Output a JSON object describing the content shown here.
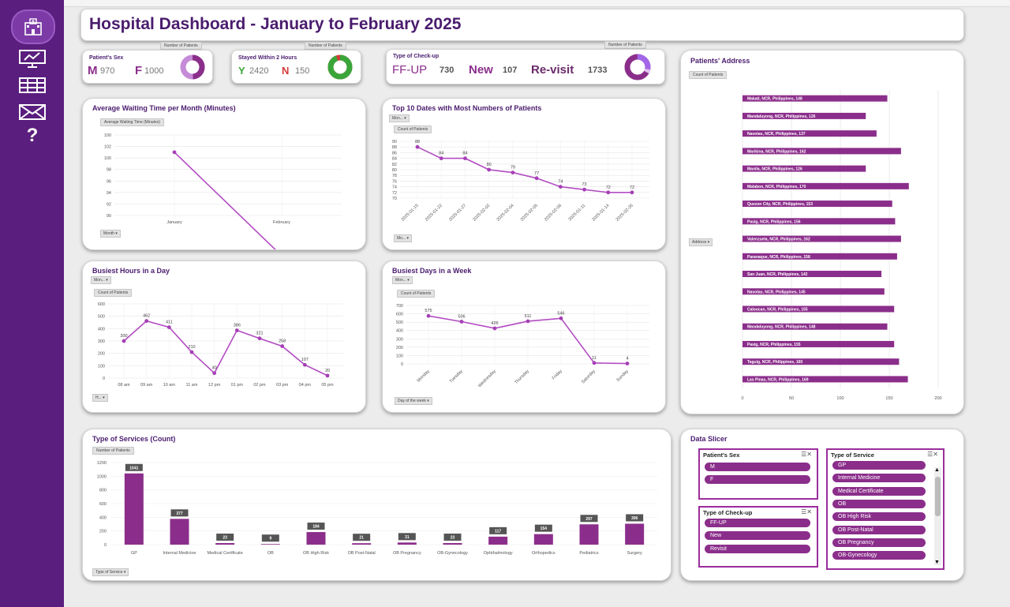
{
  "nav": {
    "icons": [
      "hospital-icon",
      "presentation-icon",
      "table-icon",
      "mail-icon",
      "help-icon"
    ],
    "help_glyph": "?"
  },
  "header": {
    "title": "Hospital Dashboard - January to February 2025"
  },
  "kpi_sex": {
    "title": "Patient's Sex",
    "pill": "Number of Patients",
    "m_letter": "M",
    "m_value": "970",
    "f_letter": "F",
    "f_value": "1000",
    "male_share": 0.49
  },
  "kpi_stayed": {
    "title": "Stayed Within 2 Hours",
    "pill": "Number of Patients",
    "y_letter": "Y",
    "y_value": "2420",
    "n_letter": "N",
    "n_value": "150",
    "yes_share": 0.94
  },
  "kpi_checkup": {
    "title": "Type of Check-up",
    "pill": "Number of Patients",
    "a_label": "FF-UP",
    "a_value": "730",
    "b_label": "New",
    "b_value": "107",
    "c_label": "Re-visit",
    "c_value": "1733"
  },
  "waiting": {
    "title": "Average Waiting Time per Month (Minutes)",
    "pill": "Average Waiting Time (Minutes)",
    "filter": "Month",
    "chart_data": {
      "type": "line",
      "categories": [
        "January",
        "February"
      ],
      "values": [
        101,
        83
      ],
      "yticks": [
        "100",
        "102",
        "100",
        "98",
        "96",
        "94",
        "92",
        "90"
      ],
      "ylim": [
        90,
        104
      ]
    }
  },
  "top_dates": {
    "title": "Top 10 Dates with Most Numbers of Patients",
    "dropdown": "Mon...",
    "pill": "Count of Patients",
    "filter": "Mo...",
    "chart_data": {
      "type": "line",
      "categories": [
        "2025-01-15",
        "2025-01-22",
        "2025-01-27",
        "2025-02-02",
        "2025-02-04",
        "2025-02-05",
        "2025-02-06",
        "2025-01-11",
        "2025-01-14",
        "2025-02-26"
      ],
      "values": [
        88,
        84,
        84,
        80,
        79,
        77,
        74,
        73,
        72,
        72
      ],
      "value_labels": [
        "88",
        "84",
        "84",
        "80",
        "79",
        "77",
        "74",
        "73",
        "72",
        "72"
      ],
      "ylim": [
        70,
        90
      ]
    }
  },
  "hours": {
    "title": "Busiest Hours in a Day",
    "dropdown": "Mon...",
    "pill": "Count of Patients",
    "filter": "H...",
    "chart_data": {
      "type": "line",
      "categories": [
        "08 am",
        "09 am",
        "10 am",
        "11 am",
        "12 pm",
        "01 pm",
        "02 pm",
        "03 pm",
        "04 pm",
        "05 pm"
      ],
      "values": [
        300,
        462,
        411,
        210,
        40,
        386,
        321,
        258,
        107,
        20
      ],
      "value_labels": [
        "300",
        "462",
        "411",
        "210",
        "40",
        "386",
        "321",
        "258",
        "107",
        "20"
      ],
      "ylim": [
        0,
        600
      ]
    }
  },
  "days": {
    "title": "Busiest Days in a Week",
    "dropdown": "Mon...",
    "pill": "Count of Patients",
    "filter": "Day of the week",
    "chart_data": {
      "type": "line",
      "categories": [
        "Monday",
        "Tuesday",
        "Wednesday",
        "Thursday",
        "Friday",
        "Saturday",
        "Sunday"
      ],
      "values": [
        575,
        506,
        426,
        511,
        546,
        11,
        4
      ],
      "value_labels": [
        "575",
        "506",
        "426",
        "511",
        "546",
        "11",
        "4"
      ],
      "ylim": [
        0,
        700
      ]
    }
  },
  "address": {
    "title": "Patients' Address",
    "pill": "Count of Patients",
    "filter": "Address",
    "chart_data": {
      "type": "bar",
      "orientation": "horizontal",
      "categories": [
        "Makati, NCR, Philippines",
        "Mandaluyong, NCR, Philippines",
        "Navotas, NCR, Philippines",
        "Marikina, NCR, Philippines",
        "Manila, NCR, Philippines",
        "Malabon, NCR, Philippines",
        "Quezon City, NCR, Philippines",
        "Pasig, NCR, Philippines",
        "Valenzuela, NCR, Philippines",
        "Paranaque, NCR, Philippines",
        "San Juan, NCR, Philippines",
        "Navotas, NCR, Philippines",
        "Caloocan, NCR, Philippines",
        "Mandaluyong, NCR, Philippines",
        "Pasig, NCR, Philippines",
        "Taguig, NCR, Philippines",
        "Las Pinas, NCR, Philippines"
      ],
      "values": [
        148,
        126,
        137,
        162,
        126,
        170,
        153,
        156,
        162,
        158,
        142,
        145,
        155,
        148,
        155,
        160,
        169
      ],
      "xticks": [
        "0",
        "50",
        "100",
        "150",
        "200"
      ],
      "xlim": [
        0,
        200
      ]
    }
  },
  "services": {
    "title": "Type of Services (Count)",
    "pill": "Number of Patients",
    "filter": "Type of Service",
    "chart_data": {
      "type": "bar",
      "categories": [
        "GP",
        "Internal Medicine",
        "Medical Certificate",
        "OB",
        "OB High Risk",
        "OB Post-Natal",
        "OB Pregnancy",
        "OB-Gynecology",
        "Ophthalmology",
        "Orthopedics",
        "Pediatrics",
        "Surgery"
      ],
      "values": [
        1041,
        377,
        23,
        9,
        184,
        21,
        31,
        23,
        117,
        154,
        297,
        306
      ],
      "value_labels": [
        "1041",
        "377",
        "23",
        "9",
        "184",
        "21",
        "31",
        "23",
        "117",
        "154",
        "297",
        "306"
      ],
      "yticks": [
        "1200",
        "1000",
        "800",
        "600",
        "400",
        "200",
        "0"
      ],
      "ylim": [
        0,
        1200
      ]
    }
  },
  "slicer": {
    "title": "Data Slicer",
    "sex": {
      "header": "Patient's Sex",
      "items": [
        "M",
        "F"
      ]
    },
    "checkup": {
      "header": "Type of Check-up",
      "items": [
        "FF-UP",
        "New",
        "Revisit"
      ]
    },
    "service": {
      "header": "Type of Service",
      "items": [
        "GP",
        "Internal Medicine",
        "Medical Certificate",
        "OB",
        "OB High Risk",
        "OB Post-Natal",
        "OB Pregnancy",
        "OB-Gynecology"
      ]
    }
  },
  "colors": {
    "purple": "#8b2e8b",
    "line": "#b24cc2",
    "dark": "#4a1c6e",
    "green": "#3aa63a",
    "red": "#d43a3a"
  }
}
